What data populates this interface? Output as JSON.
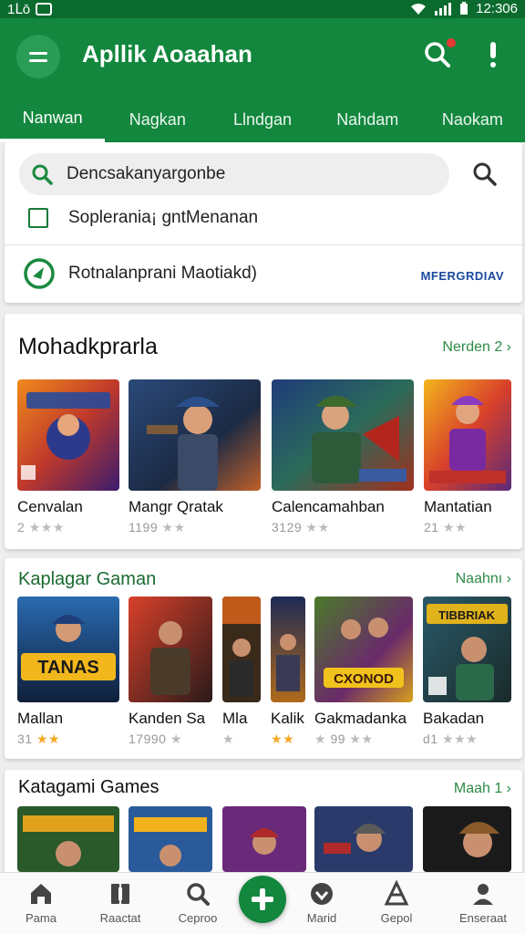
{
  "status_bar": {
    "left_text": "1ᒪō",
    "time": "12:306"
  },
  "app_bar": {
    "title": "Apllik Aoaahan",
    "menu_icon": "menu-icon",
    "search_icon": "search-icon",
    "more_icon": "more-vert-icon",
    "accent": "#12873d"
  },
  "tabs": [
    {
      "label": "Nanwan",
      "active": true
    },
    {
      "label": "Nagkan",
      "active": false
    },
    {
      "label": "Llndgan",
      "active": false
    },
    {
      "label": "Nahdam",
      "active": false
    },
    {
      "label": "Naokam",
      "active": false
    }
  ],
  "search": {
    "value": "Dencsakanyargonbe",
    "checkbox_label": "Soplerania¡ gntMenanan",
    "option_label": "Rotnalanprani Maotiakd)",
    "option_action": "MFERGRDIAV"
  },
  "sections": [
    {
      "title": "Mohadkprarla",
      "more": "Nerden 2 ›",
      "games": [
        {
          "name": "Cenvalan",
          "rating": "2",
          "stars_on": 0
        },
        {
          "name": "Mangr Qratak",
          "rating": "1199",
          "stars_on": 0
        },
        {
          "name": "Calencamahban",
          "rating": "3129",
          "stars_on": 0
        },
        {
          "name": "Mantatian",
          "rating": "21",
          "stars_on": 0
        }
      ]
    },
    {
      "title": "Kaplagar Gaman",
      "more": "Naahnı ›",
      "games": [
        {
          "name": "Mallan",
          "rating": "31",
          "stars_on": 2,
          "thumb_text": "TANAS"
        },
        {
          "name": "Kanden Sa",
          "rating": "17990",
          "stars_on": 0
        },
        {
          "name": "Mla",
          "rating": "",
          "stars_on": 0
        },
        {
          "name": "Kalik",
          "rating": "",
          "stars_on": 2
        },
        {
          "name": "Gakmadanka",
          "rating": "99",
          "stars_on": 0,
          "thumb_text": "CXONOD"
        },
        {
          "name": "Bakadan",
          "rating": "d1",
          "stars_on": 0,
          "thumb_text": "TIBBRIAK"
        }
      ]
    },
    {
      "title": "Katagami Games",
      "more": "Maah 1 ›",
      "games": [
        {
          "name": "",
          "rating": ""
        },
        {
          "name": "",
          "rating": ""
        },
        {
          "name": "",
          "rating": ""
        },
        {
          "name": "",
          "rating": ""
        },
        {
          "name": "",
          "rating": ""
        }
      ]
    }
  ],
  "bottom_nav": [
    {
      "label": "Pama",
      "icon": "home-icon"
    },
    {
      "label": "Raactat",
      "icon": "library-icon"
    },
    {
      "label": "Ceproo",
      "icon": "search-icon"
    },
    {
      "label": "Marid",
      "icon": "heart-icon"
    },
    {
      "label": "Gepol",
      "icon": "trophy-icon"
    },
    {
      "label": "Enseraat",
      "icon": "profile-icon"
    }
  ],
  "fab_icon": "add-icon"
}
